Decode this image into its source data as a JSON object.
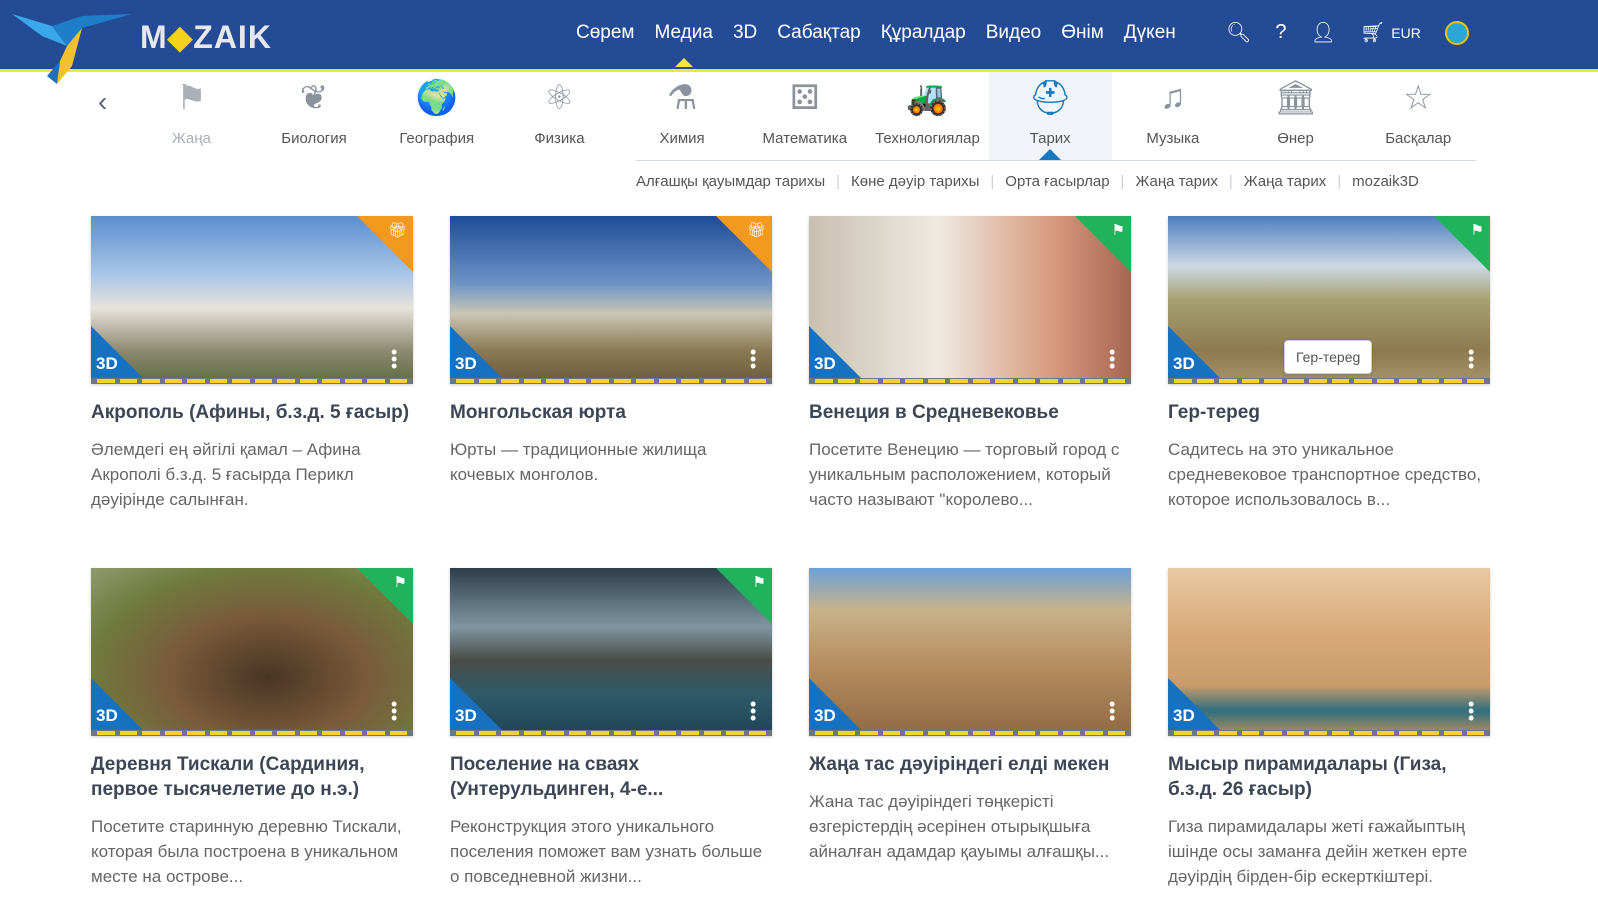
{
  "header": {
    "logo": "MOZAIK",
    "nav": [
      "Сөрем",
      "Медиа",
      "3D",
      "Сабақтар",
      "Құралдар",
      "Видео",
      "Өнім",
      "Дүкен"
    ],
    "active_nav": "Медиа",
    "currency": "EUR"
  },
  "categories": [
    {
      "label": "Жаңа",
      "icon": "flag-icon",
      "glyph": "⚑"
    },
    {
      "label": "Биология",
      "icon": "butterfly-icon",
      "glyph": "❦"
    },
    {
      "label": "География",
      "icon": "globe-icon",
      "glyph": "🌍"
    },
    {
      "label": "Физика",
      "icon": "atom-icon",
      "glyph": "⚛"
    },
    {
      "label": "Химия",
      "icon": "flask-icon",
      "glyph": "⚗"
    },
    {
      "label": "Математика",
      "icon": "dice-icon",
      "glyph": "⚄"
    },
    {
      "label": "Технологиялар",
      "icon": "car-icon",
      "glyph": "🚜"
    },
    {
      "label": "Тарих",
      "icon": "helmet-icon",
      "glyph": "⛑"
    },
    {
      "label": "Музыка",
      "icon": "lyre-icon",
      "glyph": "♫"
    },
    {
      "label": "Өнер",
      "icon": "building-icon",
      "glyph": "🏛"
    },
    {
      "label": "Басқалар",
      "icon": "star-icon",
      "glyph": "☆"
    }
  ],
  "active_category": "Тарих",
  "subcategories": [
    "Алғашқы қауымдар тарихы",
    "Көне дәуір тарихы",
    "Орта ғасырлар",
    "Жаңа тарих",
    "Жаңа тарих",
    "mozaik3D"
  ],
  "badge_3d": "3D",
  "tooltip": "Гер-тереg",
  "cards": [
    {
      "title": "Акрополь (Афины, б.з.д. 5 ғасыр)",
      "desc": "Әлемдегі ең әйгілі қамал – Афина Акрополі б.з.д. 5 ғасырда Перикл дәуірінде салынған.",
      "tag": "gift",
      "color": "#f39a1e",
      "bg": "linear-gradient(#5b8fd0 0%,#a9c6e8 35%,#e6e2da 55%,#8c8a70 80%,#5e6a40 100%)"
    },
    {
      "title": "Монгольская юрта",
      "desc": "Юрты — традиционные жилища кочевых монголов.",
      "tag": "gift",
      "color": "#f39a1e",
      "bg": "linear-gradient(#1d4d99 0%,#6c93c6 40%,#c9c6b4 58%,#8b7a55 80%,#6a5a3c 100%)"
    },
    {
      "title": "Венеция в Средневековье",
      "desc": "Посетите Венецию — торговый город с уникальным расположением, который часто называют \"королево...",
      "tag": "flag",
      "color": "#21b35b",
      "bg": "linear-gradient(90deg,#c8c0b0,#eeeae2 40%,#d79b7e 75%,#a76653)"
    },
    {
      "title": "Гер-тереg",
      "desc": "Садитесь на это уникальное средневековое транспортное средство, которое использовалось в...",
      "tag": "flag",
      "color": "#21b35b",
      "bg": "linear-gradient(#4e7fc0 0%,#cdd8e4 30%,#a6a070 50%,#8f7a50 80%,#a89468 100%)"
    },
    {
      "title": "Деревня Тискали (Сардиния, первое тысячелетие до н.э.)",
      "desc": "Посетите старинную деревню Тискали, которая была построена в уникальном месте на острове...",
      "tag": "flag",
      "color": "#21b35b",
      "bg": "radial-gradient(ellipse at 55% 65%,#4a3524 0%,#7a5b3c 40%,#6f7a3c 70%,#8e9a6c 100%)"
    },
    {
      "title": "Поселение на сваях (Унтерульдинген, 4-е...",
      "desc": "Реконструкция этого уникального поселения поможет вам узнать больше о повседневной жизни...",
      "tag": "flag",
      "color": "#21b35b",
      "bg": "linear-gradient(#2d3d4c 0%,#7f96a2 35%,#4b4c46 55%,#2f5a6a 75%,#1e4455 100%)"
    },
    {
      "title": "Жаңа тас дәуіріндегі елді мекен",
      "desc": "Жана тас дәуіріндегі төңкерісті өзгерістердің әсерінен отырықшыға айналған адамдар қауымы алғашқы...",
      "tag": "",
      "color": "",
      "bg": "linear-gradient(#6da0d8 0%,#c8b28a 25%,#b48b5c 60%,#8f6a44 100%)"
    },
    {
      "title": "Мысыр пирамидалары (Гиза, б.з.д. 26 ғасыр)",
      "desc": "Гиза пирамидалары жеті ғажайыптың ішінде осы заманға дейін жеткен ерте дәуірдің бірден-бір ескерткіштері.",
      "tag": "",
      "color": "",
      "bg": "linear-gradient(#e8c9a2 0%,#d8a878 40%,#c99b6a 70%,#2e6f80 85%,#c08d5a 100%)"
    }
  ]
}
